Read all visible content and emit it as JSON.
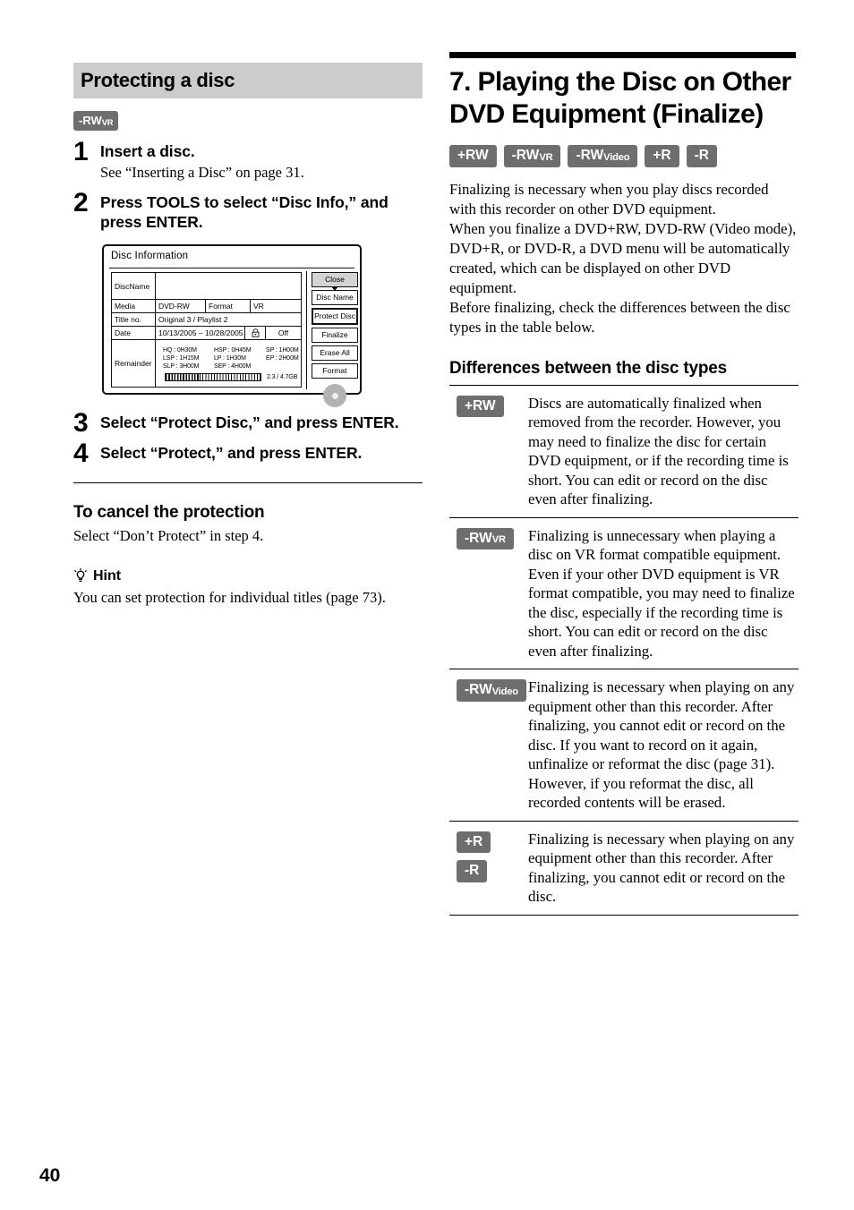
{
  "page": {
    "number": "40"
  },
  "left": {
    "section_header": "Protecting a disc",
    "disc_badge": {
      "main": "-RW",
      "sub": "VR"
    },
    "steps": [
      {
        "num": "1",
        "title": "Insert a disc.",
        "sub": "See “Inserting a Disc” on page 31."
      },
      {
        "num": "2",
        "title": "Press TOOLS to select “Disc Info,” and press ENTER.",
        "sub": ""
      },
      {
        "num": "3",
        "title": "Select “Protect Disc,” and press ENTER.",
        "sub": ""
      },
      {
        "num": "4",
        "title": "Select “Protect,” and press ENTER.",
        "sub": ""
      }
    ],
    "disc_info": {
      "title": "Disc Information",
      "rows": {
        "discname_label": "DiscName",
        "discname_value": "",
        "media_label": "Media",
        "media_value": "DVD-RW",
        "format_label": "Format",
        "format_value": "VR",
        "titleno_label": "Title no.",
        "titleno_value": "Original 3 / Playlist 2",
        "date_label": "Date",
        "date_value": "10/13/2005 – 10/28/2005",
        "lock_icon": "padlock-icon",
        "lock_value": "Off",
        "remainder_label": "Remainder"
      },
      "remainder_modes": [
        [
          "HQ : 0H30M",
          "HSP : 0H45M",
          "SP : 1H00M"
        ],
        [
          "LSP : 1H15M",
          "LP : 1H30M",
          "EP : 2H00M"
        ],
        [
          "SLP : 3H00M",
          "SEP : 4H00M",
          ""
        ]
      ],
      "capacity": "2.3 / 4.7GB",
      "buttons": [
        {
          "label": "Close",
          "state": "selected"
        },
        {
          "label": "Disc Name",
          "state": "normal"
        },
        {
          "label": "Protect Disc",
          "state": "highlight"
        },
        {
          "label": "Finalize",
          "state": "normal"
        },
        {
          "label": "Erase All",
          "state": "normal"
        },
        {
          "label": "Format",
          "state": "normal"
        }
      ]
    },
    "cancel_head": "To cancel the protection",
    "cancel_text": "Select “Don’t Protect” in step 4.",
    "hint_label": "Hint",
    "hint_icon": "lightbulb-icon",
    "hint_text": "You can set protection for individual titles (page 73)."
  },
  "right": {
    "chapter_title": "7. Playing the Disc on Other DVD Equipment (Finalize)",
    "badges": [
      {
        "main": "+RW",
        "sub": ""
      },
      {
        "main": "-RW",
        "sub": "VR"
      },
      {
        "main": "-RW",
        "sub": "Video"
      },
      {
        "main": "+R",
        "sub": ""
      },
      {
        "main": "-R",
        "sub": ""
      }
    ],
    "intro_paragraphs": [
      "Finalizing is necessary when you play discs recorded with this recorder on other DVD equipment.",
      "When you finalize a DVD+RW, DVD-RW (Video mode), DVD+R, or DVD-R, a DVD menu will be automatically created, which can be displayed on other DVD equipment.",
      "Before finalizing, check the differences between the disc types in the table below."
    ],
    "differences_head": "Differences between the disc types",
    "differences_rows": [
      {
        "badges": [
          {
            "main": "+RW",
            "sub": ""
          }
        ],
        "text": "Discs are automatically finalized when removed from the recorder. However, you may need to finalize the disc for certain DVD equipment, or if the recording time is short. You can edit or record on the disc even after finalizing."
      },
      {
        "badges": [
          {
            "main": "-RW",
            "sub": "VR"
          }
        ],
        "text": "Finalizing is unnecessary when playing a disc on VR format compatible equipment. Even if your other DVD equipment is VR format compatible, you may need to finalize the disc, especially if the recording time is short. You can edit or record on the disc even after finalizing."
      },
      {
        "badges": [
          {
            "main": "-RW",
            "sub": "Video"
          }
        ],
        "text": "Finalizing is necessary when playing on any equipment other than this recorder. After finalizing, you cannot edit or record on the disc. If you want to record on it again, unfinalize or reformat the disc (page 31). However, if you reformat the disc, all recorded contents will be erased."
      },
      {
        "badges": [
          {
            "main": "+R",
            "sub": ""
          },
          {
            "main": "-R",
            "sub": ""
          }
        ],
        "text": "Finalizing is necessary when playing on any equipment other than this recorder. After finalizing, you cannot edit or record on the disc."
      }
    ]
  },
  "colors": {
    "header_gray": "#cccccc",
    "badge_gray": "#6e6e6e",
    "rule_black": "#000000",
    "selected_button": "#d4d4d4"
  }
}
